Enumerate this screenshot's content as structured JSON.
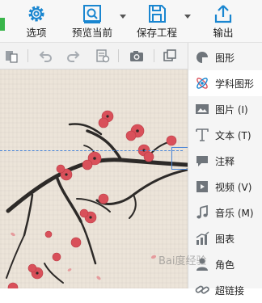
{
  "toolbar": {
    "settings_label": "选项",
    "preview_label": "预览当前",
    "save_label": "保存工程",
    "export_label": "输出"
  },
  "edit_toolbar": {
    "icons": [
      "paste-icon",
      "undo-icon",
      "redo-icon",
      "clear-format-icon",
      "camera-icon",
      "group-icon"
    ]
  },
  "panel": {
    "items": [
      {
        "label": "图形",
        "icon": "shape-icon",
        "active": false
      },
      {
        "label": "学科图形",
        "icon": "science-shape-icon",
        "active": true
      },
      {
        "label": "图片 (I)",
        "icon": "image-icon",
        "active": false
      },
      {
        "label": "文本 (T)",
        "icon": "text-icon",
        "active": false
      },
      {
        "label": "注释",
        "icon": "comment-icon",
        "active": false
      },
      {
        "label": "视频 (V)",
        "icon": "video-icon",
        "active": false
      },
      {
        "label": "音乐 (M)",
        "icon": "music-icon",
        "active": false
      },
      {
        "label": "图表",
        "icon": "chart-icon",
        "active": false
      },
      {
        "label": "角色",
        "icon": "character-icon",
        "active": false
      },
      {
        "label": "超链接",
        "icon": "hyperlink-icon",
        "active": false
      }
    ]
  },
  "watermark": "Bai度经验",
  "colors": {
    "accent": "#1a86d0",
    "blossom": "#d9505a",
    "canvas": "#ece4d9"
  }
}
